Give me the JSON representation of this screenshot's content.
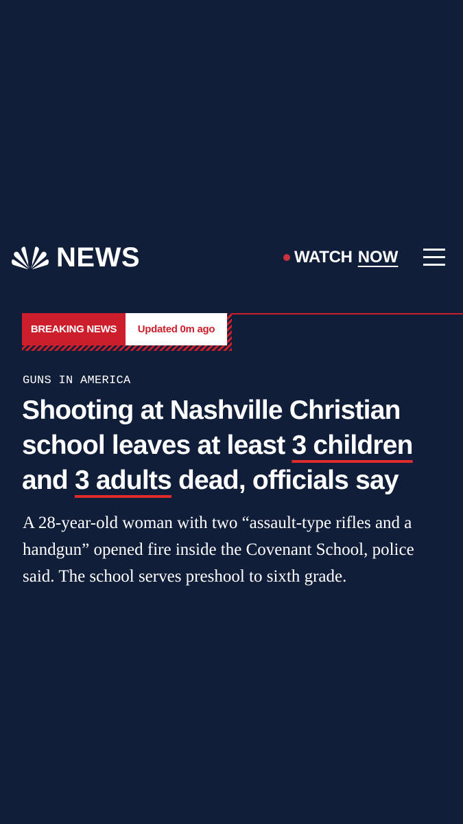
{
  "header": {
    "logo_text": "NEWS",
    "logo_icon": "nbc-peacock-icon",
    "watch_label": "WATCH",
    "watch_now": "NOW",
    "menu_icon": "hamburger-menu-icon"
  },
  "banner": {
    "label": "BREAKING NEWS",
    "updated": "Updated 0m ago"
  },
  "article": {
    "kicker": "GUNS IN AMERICA",
    "headline": {
      "part1": "Shooting at Nashville Christian school leaves at least ",
      "highlight1": "3 children",
      "part2": " and ",
      "highlight2": "3 adults",
      "part3": " dead, officials say"
    },
    "dek": "A 28-year-old woman with two “assault-type rifles and a handgun” opened fire inside the Covenant School, police said. The school serves preshool to sixth grade."
  },
  "colors": {
    "background": "#111e39",
    "accent_red": "#cc1f2b",
    "watch_dot": "#c8323d",
    "text": "#ffffff"
  }
}
